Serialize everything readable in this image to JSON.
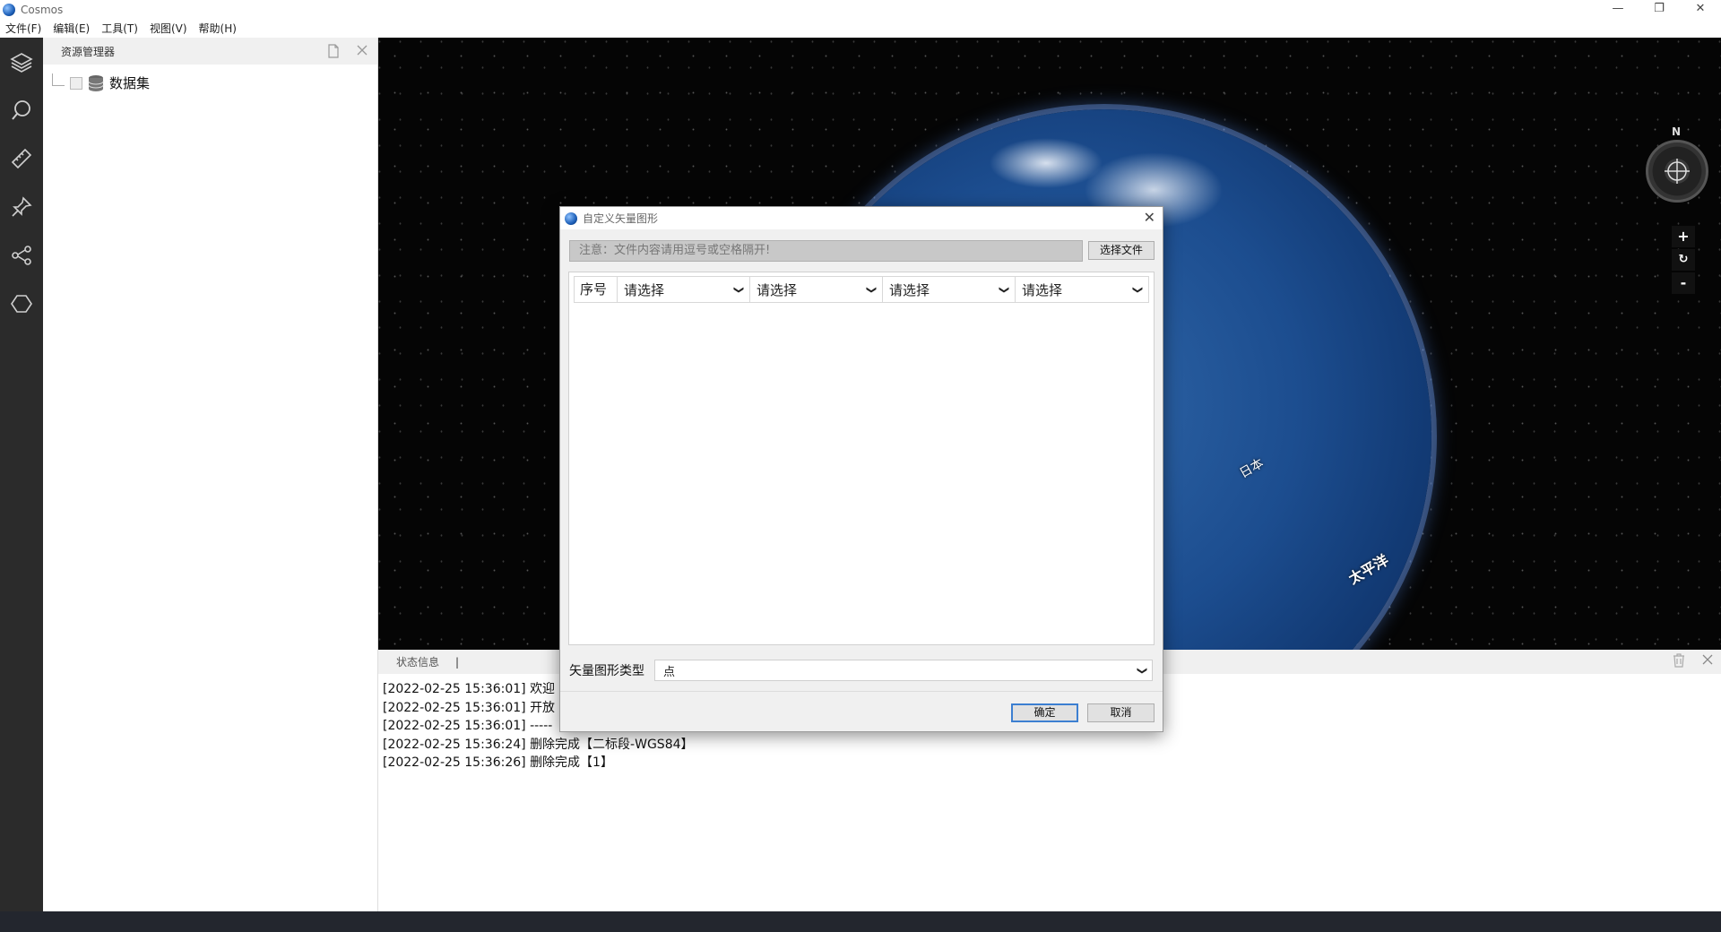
{
  "window": {
    "title": "Cosmos",
    "controls": [
      "—",
      "❐",
      "✕"
    ]
  },
  "menu": [
    "文件(F)",
    "编辑(E)",
    "工具(T)",
    "视图(V)",
    "帮助(H)"
  ],
  "rail_icons": [
    "layers-icon",
    "search-icon",
    "ruler-icon",
    "pin-icon",
    "share-icon",
    "hexagon-icon"
  ],
  "resource_panel": {
    "title": "资源管理器",
    "tree": [
      {
        "label": "数据集",
        "checked": false
      }
    ]
  },
  "globe": {
    "labels": [
      "日本",
      "太平洋"
    ],
    "compass_label": "N",
    "zoom": {
      "in": "+",
      "reset": "↻",
      "out": "-"
    }
  },
  "status_panel": {
    "title": "状态信息",
    "separator": "|",
    "log": [
      "[2022-02-25 15:36:01] 欢迎",
      "[2022-02-25 15:36:01] 开放",
      "[2022-02-25 15:36:01] -----",
      "[2022-02-25 15:36:24] 删除完成【二标段-WGS84】",
      "[2022-02-25 15:36:26] 删除完成【1】"
    ]
  },
  "dialog": {
    "title": "自定义矢量图形",
    "notice": "注意：文件内容请用逗号或空格隔开!",
    "choose_file": "选择文件",
    "columns": {
      "index": "序号",
      "selects": [
        "请选择",
        "请选择",
        "请选择",
        "请选择"
      ]
    },
    "type_label": "矢量图形类型",
    "type_value": "点",
    "ok": "确定",
    "cancel": "取消"
  },
  "colors": {
    "rail": "#2b2b2b",
    "primary_border": "#3c7fd1",
    "viewport": "#050505"
  }
}
